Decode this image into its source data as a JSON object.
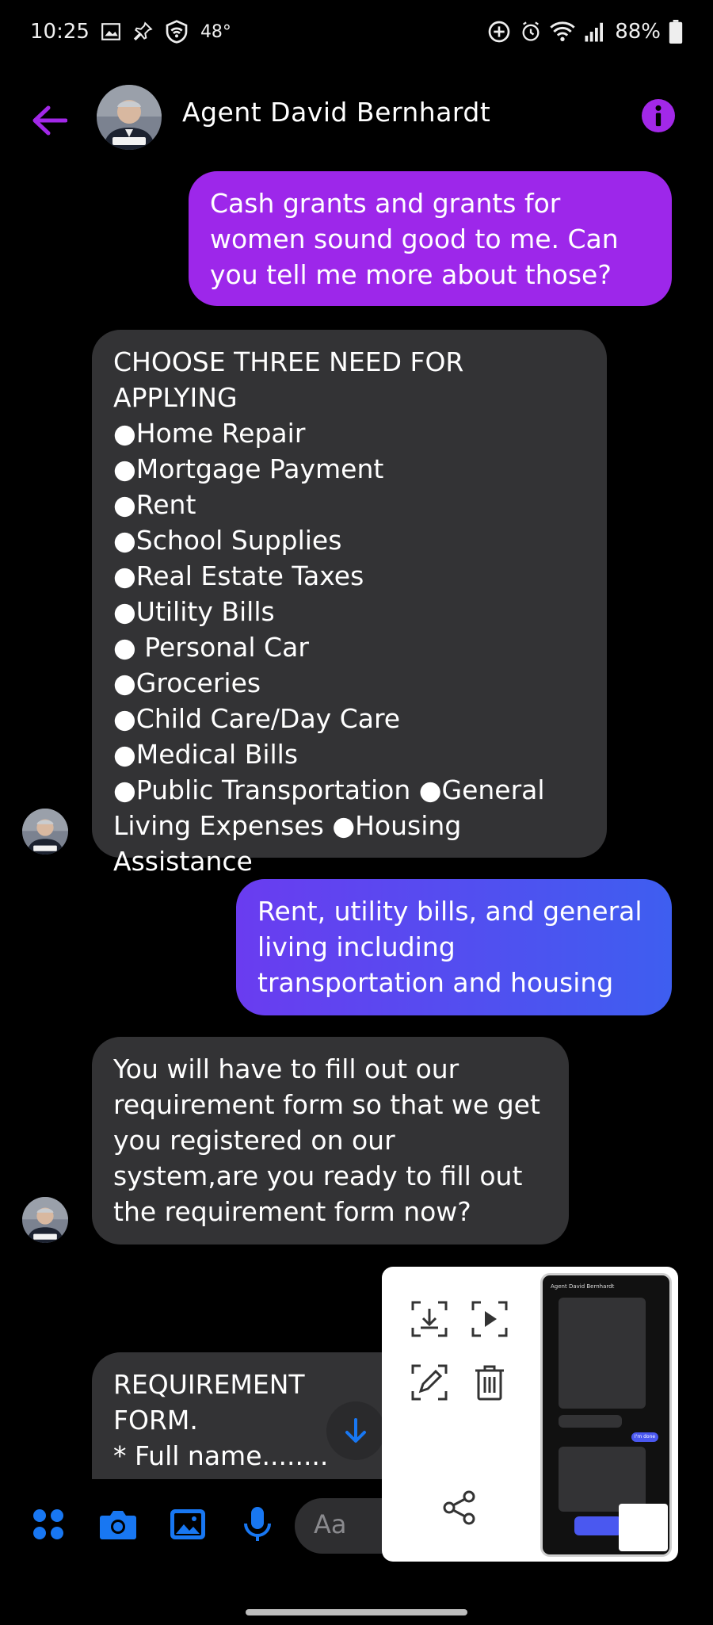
{
  "status_bar": {
    "time": "10:25",
    "temperature": "48°",
    "battery": "88%"
  },
  "header": {
    "contact_name": "Agent David Bernhardt",
    "back_icon": "arrow-left-icon",
    "info_icon": "info-icon"
  },
  "messages": [
    {
      "direction": "outgoing",
      "text": "Cash grants and grants for women sound good to me. Can you tell me more about those?"
    },
    {
      "direction": "incoming",
      "text": "CHOOSE THREE NEED FOR  APPLYING\n●Home Repair\n●Mortgage Payment\n●Rent\n●School Supplies\n●Real Estate Taxes\n●Utility Bills\n● Personal Car\n●Groceries\n●Child Care/Day Care\n●Medical Bills\n●Public Transportation ●General Living Expenses ●Housing Assistance"
    },
    {
      "direction": "outgoing",
      "text": "Rent, utility bills, and general living including transportation and housing"
    },
    {
      "direction": "incoming",
      "text": "You will have to fill out our requirement form so that we get you registered on our system,are you ready to fill out the requirement form now?"
    },
    {
      "direction": "incoming",
      "text": "REQUIREMENT FORM.\n* Full name........\n*Home Address.."
    }
  ],
  "composer": {
    "placeholder": "Aa",
    "tools": [
      "apps-icon",
      "camera-icon",
      "gallery-icon",
      "microphone-icon"
    ]
  },
  "screenshot_popup": {
    "actions": [
      "save-icon",
      "record-icon",
      "edit-icon",
      "delete-icon",
      "share-icon"
    ],
    "thumbnail_title": "Agent David Bernhardt",
    "thumbnail_reply": "I'm done"
  },
  "colors": {
    "accent": "#a228e8",
    "outgoing_purple": "#9d27ea",
    "outgoing_blue": "#4a58f0",
    "incoming": "#333335",
    "icon_blue": "#1877f2"
  }
}
